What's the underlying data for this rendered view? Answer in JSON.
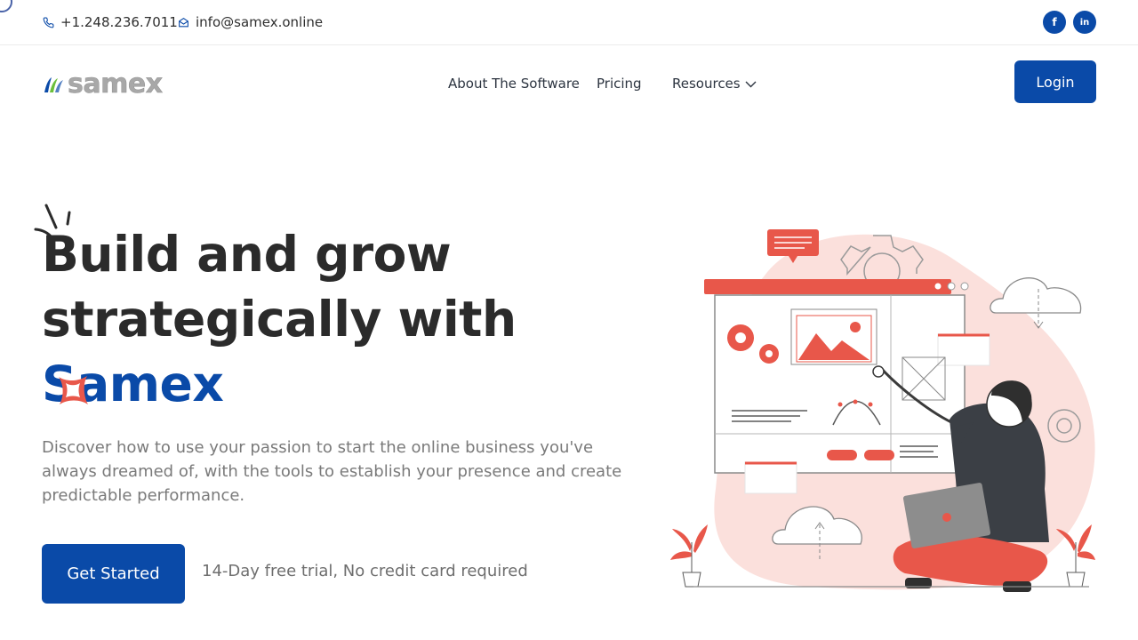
{
  "topbar": {
    "phone": "+1.248.236.7011",
    "email": "info@samex.online",
    "social": [
      {
        "icon": "facebook-icon",
        "glyph": "f"
      },
      {
        "icon": "linkedin-icon",
        "glyph": "in"
      }
    ]
  },
  "header": {
    "logo_text": "samex",
    "nav": {
      "about": "About The Software",
      "pricing": "Pricing",
      "resources": "Resources"
    },
    "login_label": "Login"
  },
  "hero": {
    "title_line1": "Build and grow",
    "title_line2_prefix": "strategically with ",
    "title_accent": "Samex",
    "description": "Discover how to use your passion to start the online business you've always dreamed of, with the tools to establish your presence and create predictable performance.",
    "cta_label": "Get Started",
    "trial_note": "14-Day free trial, No credit card required"
  },
  "colors": {
    "brand_blue": "#0a4aa8",
    "accent_coral": "#e8574a",
    "blob_pink": "#fbe0dc"
  }
}
